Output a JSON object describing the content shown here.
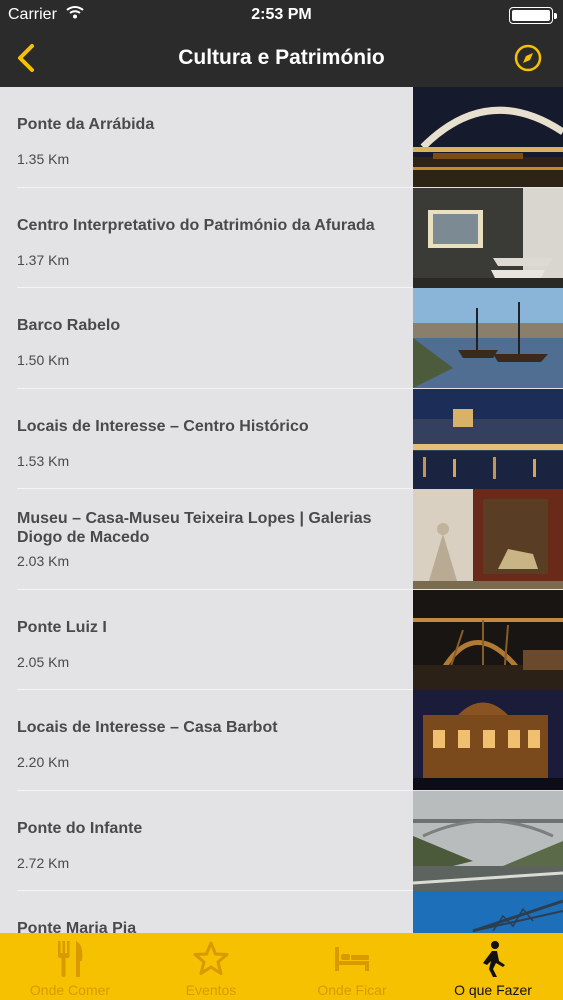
{
  "status_bar": {
    "carrier": "Carrier",
    "time": "2:53 PM"
  },
  "nav": {
    "title": "Cultura e Património"
  },
  "items": [
    {
      "name": "Ponte da Arrábida",
      "distance": "1.35 Km"
    },
    {
      "name": "Centro Interpretativo do Património da Afurada",
      "distance": "1.37 Km"
    },
    {
      "name": "Barco Rabelo",
      "distance": "1.50 Km"
    },
    {
      "name": "Locais de Interesse – Centro Histórico",
      "distance": "1.53 Km"
    },
    {
      "name": "Museu – Casa-Museu Teixeira Lopes | Galerias Diogo de Macedo",
      "distance": "2.03 Km"
    },
    {
      "name": "Ponte Luiz I",
      "distance": "2.05 Km"
    },
    {
      "name": "Locais de Interesse – Casa Barbot",
      "distance": "2.20 Km"
    },
    {
      "name": "Ponte do Infante",
      "distance": "2.72 Km"
    },
    {
      "name": "Ponte Maria Pia",
      "distance": ""
    }
  ],
  "tabs": [
    {
      "label": "Onde Comer",
      "icon": "fork-knife-icon",
      "active": false
    },
    {
      "label": "Eventos",
      "icon": "star-icon",
      "active": false
    },
    {
      "label": "Onde Ficar",
      "icon": "bed-icon",
      "active": false
    },
    {
      "label": "O que Fazer",
      "icon": "walking-person-icon",
      "active": true
    }
  ],
  "colors": {
    "accent": "#f6c100",
    "bar": "#2b2b2b",
    "row_bg": "#e3e2e4"
  }
}
